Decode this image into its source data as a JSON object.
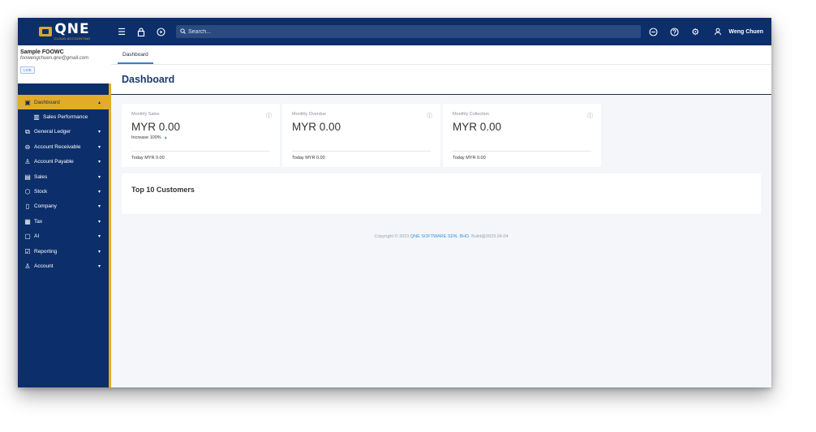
{
  "logo": {
    "word": "QNE",
    "sub": "CLOUD ACCOUNTING"
  },
  "topbar": {
    "search_placeholder": "Search...",
    "user_name": "Weng Chuen"
  },
  "company": {
    "name": "Sample FOOWC",
    "email": "foowengchuen.qne@gmail.com",
    "badge": "LIVE"
  },
  "nav": {
    "items": [
      {
        "label": "Dashboard",
        "icon": "dashboard-icon"
      },
      {
        "label": "Sales Performance",
        "icon": "chart-icon"
      },
      {
        "label": "General Ledger",
        "icon": "ledger-icon"
      },
      {
        "label": "Account Receivable",
        "icon": "receivable-icon"
      },
      {
        "label": "Account Payable",
        "icon": "payable-icon"
      },
      {
        "label": "Sales",
        "icon": "sales-icon"
      },
      {
        "label": "Stock",
        "icon": "stock-icon"
      },
      {
        "label": "Company",
        "icon": "company-icon"
      },
      {
        "label": "Tax",
        "icon": "tax-icon"
      },
      {
        "label": "AI",
        "icon": "ai-icon"
      },
      {
        "label": "Reporting",
        "icon": "reporting-icon"
      },
      {
        "label": "Account",
        "icon": "account-icon"
      }
    ]
  },
  "tabs": [
    {
      "label": "Dashboard"
    }
  ],
  "page": {
    "title": "Dashboard"
  },
  "cards": [
    {
      "label": "Monthly Sales",
      "value": "MYR 0.00",
      "trend": "Increase 100%",
      "footer": "Today MYR 0.00"
    },
    {
      "label": "Monthly Overdue",
      "value": "MYR 0.00",
      "footer": "Today MYR 0.00"
    },
    {
      "label": "Monthly Collection",
      "value": "MYR 0.00",
      "footer": "Today MYR 0.00"
    }
  ],
  "top_customers": {
    "title": "Top 10 Customers"
  },
  "footer": {
    "prefix": "Copyright © 2023 ",
    "company": "QNE SOFTWARE SDN. BHD.",
    "suffix": " Build@2023.04.04"
  },
  "colors": {
    "navy": "#0c2f6b",
    "gold": "#e2ac28",
    "link": "#3d8fe0"
  }
}
